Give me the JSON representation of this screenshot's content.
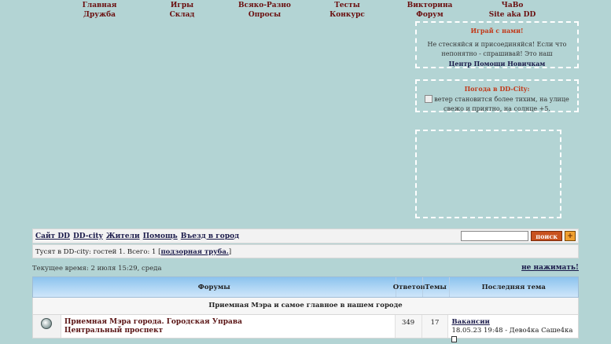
{
  "top_nav": {
    "row1": [
      "Главная",
      "Игры",
      "Всяко-Разно",
      "Тесты",
      "Викторина",
      "ЧаВо"
    ],
    "row2": [
      "Дружба",
      "Склад",
      "Опросы",
      "Конкурс",
      "Форум",
      "Site aka DD"
    ]
  },
  "help_box": {
    "title": "Играй с нами!",
    "text": "Не стесняйся и присоединяйся! Если что непонятно - спрашивай! Это наш",
    "link": "Центр Помощи Новичкам"
  },
  "weather_box": {
    "title": "Погода в DD-City:",
    "text": "ветер становится более тихим, на улице свежо и приятно, на солнце +5."
  },
  "navbar": {
    "links": [
      "Сайт DD",
      "DD-city",
      "Жители",
      "Помощь",
      "Въезд в город"
    ],
    "search_button": "поиск",
    "plus_button": "+"
  },
  "online": {
    "text": "Тусят в DD-city: гостей 1. Всего: 1 [",
    "link": "подзорная труба.",
    "end": "]"
  },
  "time_line": "Текущее время: 2 июля 15:29, среда",
  "no_press": "не нажимать!",
  "forum_table": {
    "headers": {
      "forums": "Форумы",
      "replies": "Ответов",
      "topics": "Темы",
      "last": "Последняя тема"
    },
    "category": "Приемная Мэра и самое главное в нашем городе",
    "rows": [
      {
        "title": "Приемная Мэра города. Городская Управа",
        "subforum": "Центральный проспект",
        "replies": "349",
        "topics": "17",
        "last_topic": "Вакансии",
        "last_meta": "18.05.23 19:48 - Дево4ка Саше4ка"
      }
    ]
  }
}
